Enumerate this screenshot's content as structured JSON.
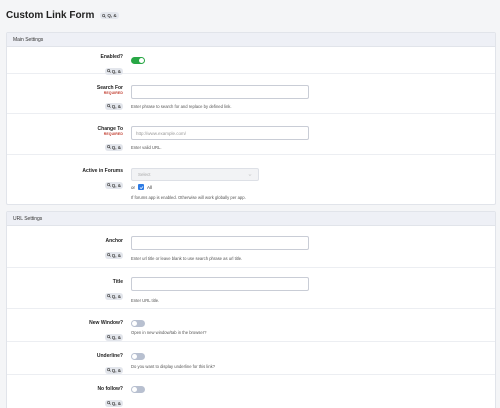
{
  "page": {
    "title": "Custom Link Form",
    "id_badge": "Q, &"
  },
  "badge_text": "Q, &",
  "sections": {
    "main": "Main Settings",
    "url": "URL Settings"
  },
  "fields": {
    "enabled": {
      "label": "Enabled?",
      "value": true
    },
    "search_for": {
      "label": "Search For",
      "required": "REQUIRED",
      "value": "",
      "placeholder": "",
      "help": "Enter phrase to search for and replace by defined link."
    },
    "change_to": {
      "label": "Change To",
      "required": "REQUIRED",
      "value": "",
      "placeholder": "http://www.example.com/",
      "help": "Enter valid URL."
    },
    "active_in_forums": {
      "label": "Active in Forums",
      "select_placeholder": "Select",
      "or_text": "or",
      "all_label": "All",
      "all_checked": true,
      "help": "If forums app is enabled. Otherwise will work globally per app."
    },
    "anchor": {
      "label": "Anchor",
      "value": "",
      "placeholder": "",
      "help": "Enter url title or leave blank to use search phrase as url title."
    },
    "title": {
      "label": "Title",
      "value": "",
      "placeholder": "",
      "help": "Enter URL title."
    },
    "new_window": {
      "label": "New Window?",
      "value": false,
      "help": "Open in new window/tab in the browser?"
    },
    "underline": {
      "label": "Underline?",
      "value": false,
      "help": "Do you want to display underline for this link?"
    },
    "no_follow": {
      "label": "No follow?",
      "value": false
    }
  },
  "colors": {
    "toggle_on": "#28a745",
    "toggle_off": "#b8c0d0",
    "checkbox": "#2d7be5",
    "required": "#c0392b"
  }
}
